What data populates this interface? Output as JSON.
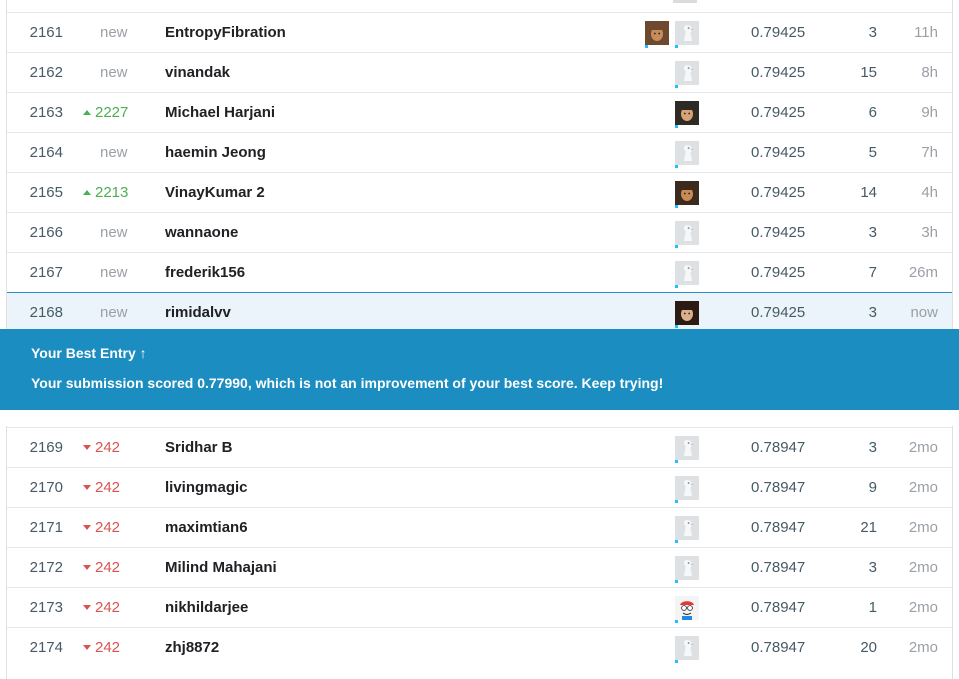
{
  "rows_top": [
    {
      "rank": "2161",
      "change": "new",
      "change_type": "new",
      "name": "EntropyFibration",
      "avatars": [
        "photo",
        "default"
      ],
      "score": "0.79425",
      "entries": "3",
      "last": "11h"
    },
    {
      "rank": "2162",
      "change": "new",
      "change_type": "new",
      "name": "vinandak",
      "avatars": [
        "default"
      ],
      "score": "0.79425",
      "entries": "15",
      "last": "8h"
    },
    {
      "rank": "2163",
      "change": "2227",
      "change_type": "up",
      "name": "Michael Harjani",
      "avatars": [
        "photo-face2"
      ],
      "score": "0.79425",
      "entries": "6",
      "last": "9h"
    },
    {
      "rank": "2164",
      "change": "new",
      "change_type": "new",
      "name": "haemin Jeong",
      "avatars": [
        "default"
      ],
      "score": "0.79425",
      "entries": "5",
      "last": "7h"
    },
    {
      "rank": "2165",
      "change": "2213",
      "change_type": "up",
      "name": "VinayKumar 2",
      "avatars": [
        "photo-face3"
      ],
      "score": "0.79425",
      "entries": "14",
      "last": "4h"
    },
    {
      "rank": "2166",
      "change": "new",
      "change_type": "new",
      "name": "wannaone",
      "avatars": [
        "default"
      ],
      "score": "0.79425",
      "entries": "3",
      "last": "3h"
    },
    {
      "rank": "2167",
      "change": "new",
      "change_type": "new",
      "name": "frederik156",
      "avatars": [
        "default"
      ],
      "score": "0.79425",
      "entries": "7",
      "last": "26m"
    },
    {
      "rank": "2168",
      "change": "new",
      "change_type": "new",
      "name": "rimidalvv",
      "avatars": [
        "photo-face4"
      ],
      "score": "0.79425",
      "entries": "3",
      "last": "now"
    }
  ],
  "banner": {
    "title": "Your Best Entry",
    "arrow": "↑",
    "message": "Your submission scored 0.77990, which is not an improvement of your best score. Keep trying!",
    "color": "#1b8dc0"
  },
  "rows_bottom": [
    {
      "rank": "2169",
      "change": "242",
      "change_type": "down",
      "name": "Sridhar B",
      "avatars": [
        "default"
      ],
      "score": "0.78947",
      "entries": "3",
      "last": "2mo"
    },
    {
      "rank": "2170",
      "change": "242",
      "change_type": "down",
      "name": "livingmagic",
      "avatars": [
        "default"
      ],
      "score": "0.78947",
      "entries": "9",
      "last": "2mo"
    },
    {
      "rank": "2171",
      "change": "242",
      "change_type": "down",
      "name": "maximtian6",
      "avatars": [
        "default"
      ],
      "score": "0.78947",
      "entries": "21",
      "last": "2mo"
    },
    {
      "rank": "2172",
      "change": "242",
      "change_type": "down",
      "name": "Milind Mahajani",
      "avatars": [
        "default"
      ],
      "score": "0.78947",
      "entries": "3",
      "last": "2mo"
    },
    {
      "rank": "2173",
      "change": "242",
      "change_type": "down",
      "name": "nikhildarjee",
      "avatars": [
        "cartoon"
      ],
      "score": "0.78947",
      "entries": "1",
      "last": "2mo"
    },
    {
      "rank": "2174",
      "change": "242",
      "change_type": "down",
      "name": "zhj8872",
      "avatars": [
        "default"
      ],
      "score": "0.78947",
      "entries": "20",
      "last": "2mo"
    }
  ],
  "colors": {
    "up": "#4caf50",
    "down": "#d9534f",
    "accent": "#20beff",
    "highlight": "#eaf4fa"
  },
  "icons": {
    "default_avatar": "default-avatar-icon",
    "arrow_up": "arrow-up-icon",
    "triangle_up": "triangle-up-icon",
    "triangle_down": "triangle-down-icon"
  }
}
